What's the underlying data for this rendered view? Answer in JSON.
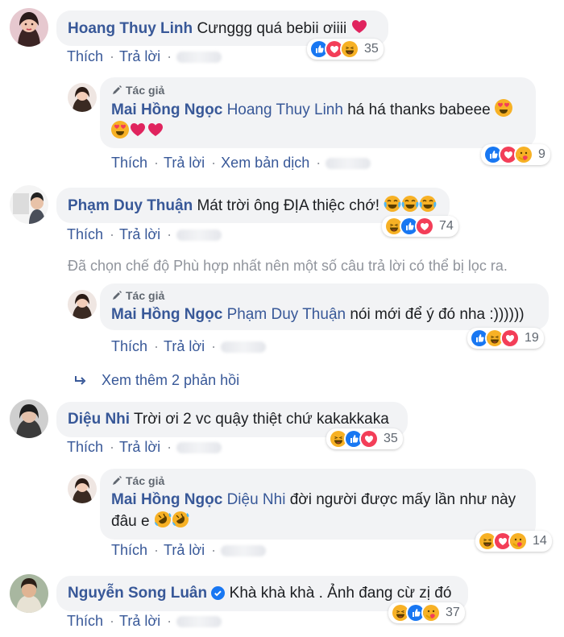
{
  "actions": {
    "like": "Thích",
    "reply": "Trả lời",
    "translate": "Xem bản dịch",
    "dot": "·"
  },
  "author_tag": "Tác giả",
  "comments": [
    {
      "author": "Hoang Thuy Linh",
      "text": "Cưnggg quá bebii ơiiii",
      "reaction_count": "35"
    },
    {
      "author": "Mai Hồng Ngọc",
      "mention": "Hoang Thuy Linh",
      "text": "há há thanks babeee",
      "reaction_count": "9"
    },
    {
      "author": "Phạm Duy Thuận",
      "text": "Mát trời ông ĐỊA thiệc chớ!",
      "reaction_count": "74"
    },
    {
      "author": "Mai Hồng Ngọc",
      "mention": "Phạm Duy Thuận",
      "text": "nói mới để ý đó nha :))))))",
      "reaction_count": "19"
    },
    {
      "author": "Diệu Nhi",
      "text": "Trời ơi 2 vc quậy thiệt chứ kakakkaka",
      "reaction_count": "35"
    },
    {
      "author": "Mai Hồng Ngọc",
      "mention": "Diệu Nhi",
      "text_line1": "đời người được mấy lần như này",
      "text_line2": "đâu e",
      "reaction_count": "14"
    },
    {
      "author": "Nguyễn Song Luân",
      "text": "Khà khà khà . Ảnh đang cừ zị đó",
      "reaction_count": "37"
    }
  ],
  "filter_note": "Đã chọn chế độ Phù hợp nhất nên một số câu trả lời có thể bị lọc ra.",
  "more_replies": "Xem thêm 2 phản hồi",
  "colors": {
    "link": "#385898",
    "bubble": "#f2f3f5",
    "like": "#1877f2",
    "love": "#f33e58",
    "haha": "#f7b125"
  },
  "icons": [
    "heart-emoji",
    "heart-eyes-emoji",
    "joy-emoji",
    "rofl-emoji",
    "like-reaction-icon",
    "love-reaction-icon",
    "haha-reaction-icon",
    "care-reaction-icon",
    "verified-badge-icon",
    "pencil-icon",
    "reply-arrow-icon"
  ]
}
